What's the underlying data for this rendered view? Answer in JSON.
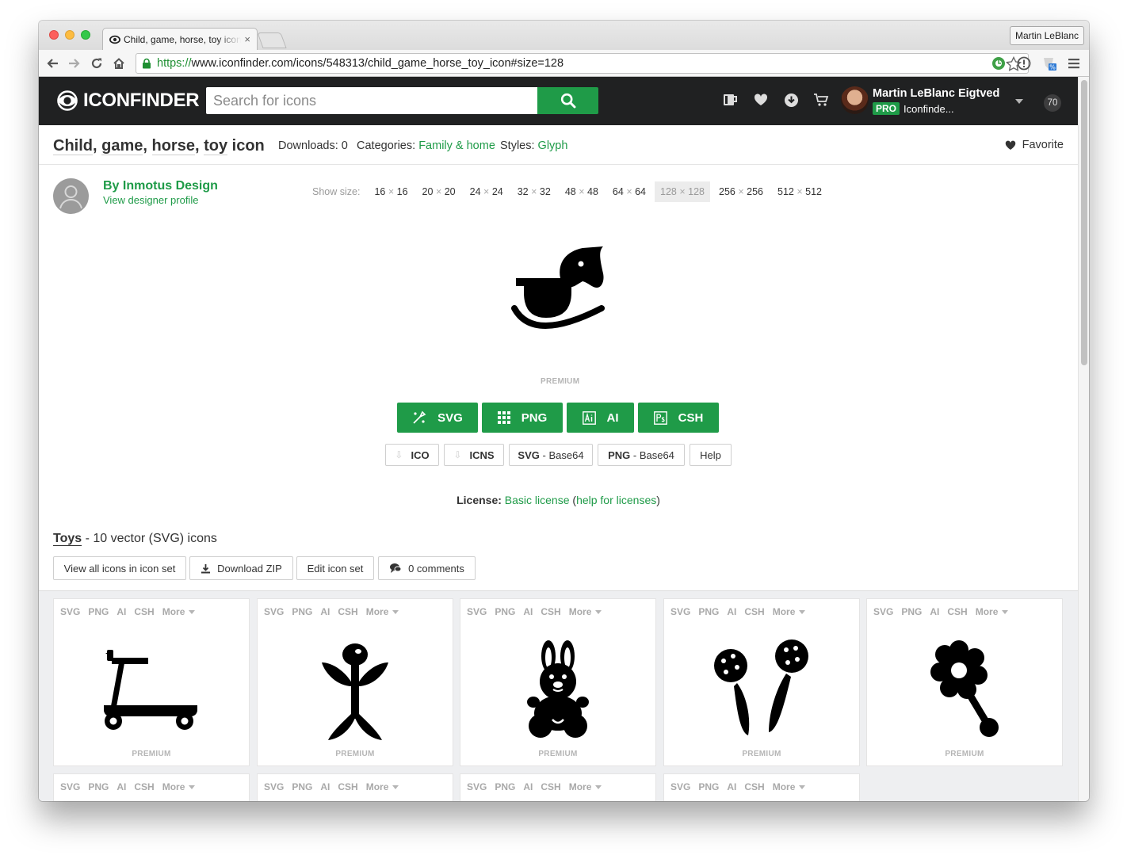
{
  "browser": {
    "tab_title": "Child, game, horse, toy icon",
    "tab_close": "×",
    "profile": "Martin LeBlanc",
    "url_scheme": "https://",
    "url_rest": "www.iconfinder.com/icons/548313/child_game_horse_toy_icon#size=128"
  },
  "header": {
    "logo": "ICONFINDER",
    "search_placeholder": "Search for icons",
    "user_name": "Martin LeBlanc Eigtved",
    "pro_label": "PRO",
    "team": "Iconfinde...",
    "notifications": "70"
  },
  "icon": {
    "title_tags": [
      "Child",
      "game",
      "horse",
      "toy"
    ],
    "title_suffix": "icon",
    "downloads_label": "Downloads:",
    "downloads": "0",
    "categories_label": "Categories:",
    "category": "Family & home",
    "styles_label": "Styles:",
    "style": "Glyph",
    "favorite": "Favorite",
    "premium": "PREMIUM"
  },
  "designer": {
    "name": "By Inmotus Design",
    "profile_link": "View designer profile"
  },
  "sizes": {
    "label": "Show size:",
    "times": "×",
    "options": [
      {
        "w": "16",
        "h": "16"
      },
      {
        "w": "20",
        "h": "20"
      },
      {
        "w": "24",
        "h": "24"
      },
      {
        "w": "32",
        "h": "32"
      },
      {
        "w": "48",
        "h": "48"
      },
      {
        "w": "64",
        "h": "64"
      },
      {
        "w": "128",
        "h": "128"
      },
      {
        "w": "256",
        "h": "256"
      },
      {
        "w": "512",
        "h": "512"
      }
    ],
    "selected": "128"
  },
  "downloads": {
    "primary": [
      "SVG",
      "PNG",
      "AI",
      "CSH"
    ],
    "ico": "ICO",
    "icns": "ICNS",
    "svg_b64_format": "SVG",
    "png_b64_format": "PNG",
    "b64_suffix": "- Base64",
    "help": "Help"
  },
  "license": {
    "label": "License:",
    "name": "Basic license",
    "open_paren": "(",
    "help": "help for licenses",
    "close_paren": ")"
  },
  "iconset": {
    "name": "Toys",
    "summary": "- 10 vector (SVG) icons",
    "view_all": "View all icons in icon set",
    "download_zip": "Download ZIP",
    "edit": "Edit icon set",
    "comments": "0 comments"
  },
  "grid": {
    "formats": [
      "SVG",
      "PNG",
      "AI",
      "CSH",
      "More"
    ],
    "premium": "PREMIUM",
    "icons": [
      "scooter-icon",
      "rubber-toy-icon",
      "teddy-bunny-icon",
      "maracas-icon",
      "flower-rattle-icon"
    ]
  },
  "colors": {
    "brand_green": "#1f9b48",
    "header_dark": "#202122"
  }
}
